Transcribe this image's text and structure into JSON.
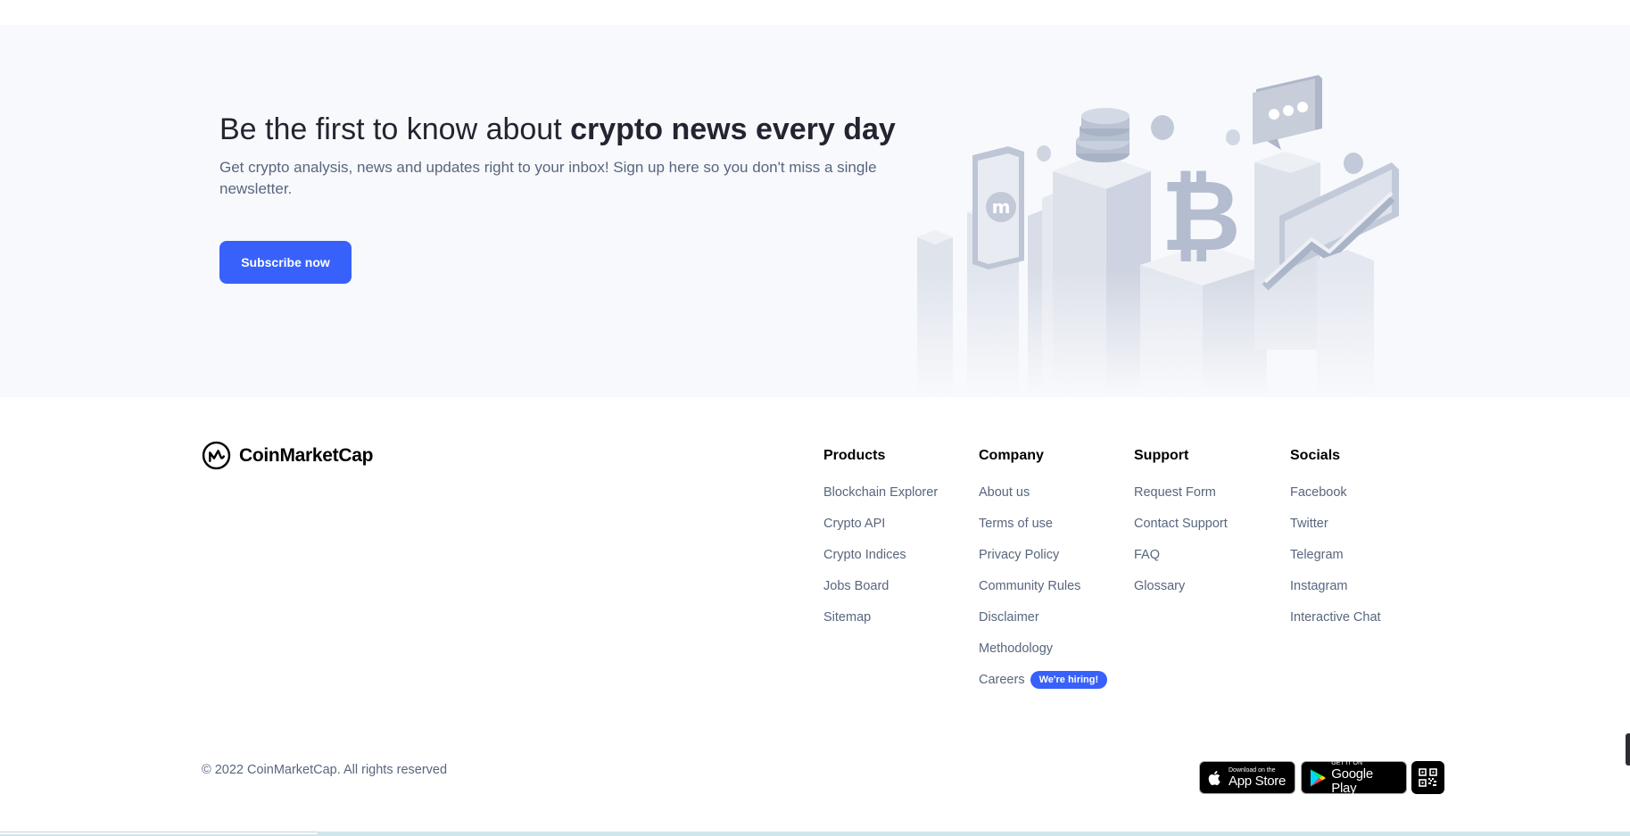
{
  "newsletter": {
    "title_regular": "Be the first to know about ",
    "title_bold": "crypto news every day",
    "description": "Get crypto analysis, news and updates right to your inbox! Sign up here so you don't miss a single newsletter.",
    "subscribe_label": "Subscribe now"
  },
  "brand": {
    "name": "CoinMarketCap"
  },
  "footer": {
    "columns": [
      {
        "heading": "Products",
        "links": [
          "Blockchain Explorer",
          "Crypto API",
          "Crypto Indices",
          "Jobs Board",
          "Sitemap"
        ]
      },
      {
        "heading": "Company",
        "links": [
          "About us",
          "Terms of use",
          "Privacy Policy",
          "Community Rules",
          "Disclaimer",
          "Methodology",
          "Careers"
        ]
      },
      {
        "heading": "Support",
        "links": [
          "Request Form",
          "Contact Support",
          "FAQ",
          "Glossary"
        ]
      },
      {
        "heading": "Socials",
        "links": [
          "Facebook",
          "Twitter",
          "Telegram",
          "Instagram",
          "Interactive Chat"
        ]
      }
    ],
    "hiring_badge": "We're hiring!",
    "copyright": "© 2022 CoinMarketCap. All rights reserved",
    "app_store": {
      "small": "Download on the",
      "big": "App Store"
    },
    "google_play": {
      "small": "GET IT ON",
      "big": "Google Play"
    }
  },
  "icons": {
    "logo": "coinmarketcap-logo-icon",
    "apple": "apple-icon",
    "play": "google-play-icon",
    "qr": "qr-code-icon"
  },
  "colors": {
    "accent": "#3861fb",
    "text_primary": "#222531",
    "text_secondary": "#58667e",
    "newsletter_bg": "#f8f9fc"
  }
}
